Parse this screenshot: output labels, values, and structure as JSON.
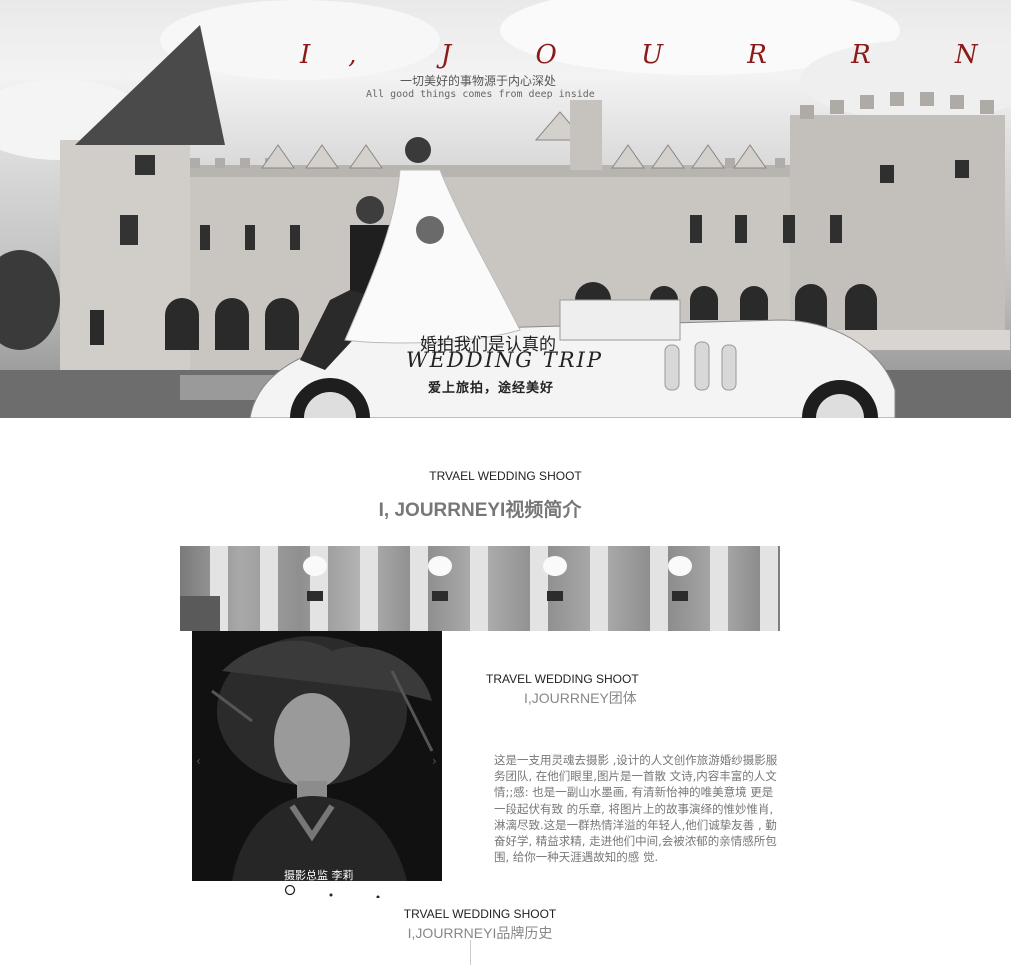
{
  "hero": {
    "title": "I, J O U R R N E Y",
    "subtitle_cn": "一切美好的事物源于内心深处",
    "subtitle_en": "All good things comes from deep inside",
    "tagline_cn": "婚拍我们是认真的",
    "tagline_en": "WEDDING TRIP",
    "tagline_sub": "爱上旅拍，途经美好"
  },
  "intro": {
    "label_en": "TRVAEL WEDDING SHOOT",
    "title": "I, JOURRNEYI视频简介"
  },
  "team": {
    "label_en": "TRAVEL WEDDING SHOOT",
    "title": "I,JOURRNEY团体",
    "description": "这是一支用灵魂去摄影 ,设计的人文创作旅游婚纱摄影服务团队, 在他们眼里,图片是一首散 文诗,内容丰富的人文情;;感: 也是一副山水墨画, 有清新怡神的唯美意境 更是一段起伏有致 的乐章, 将图片上的故事演绎的惟妙惟肖,淋漓尽致.这是一群热情洋溢的年轻人,他们诚挚友善 , 勤奋好学, 精益求精, 走进他们中间,会被浓郁的亲情感所包围, 给你一种天涯遇故知的感 觉.",
    "portrait_caption": "摄影总监  李莉",
    "slider_count": 3,
    "active_slide": 1
  },
  "history": {
    "label_en": "TRVAEL WEDDING SHOOT",
    "title": "I,JOURRNEYI品牌历史"
  },
  "colors": {
    "title_red": "#8b1a1a",
    "heading_gray": "#777777",
    "body_gray": "#777777"
  }
}
